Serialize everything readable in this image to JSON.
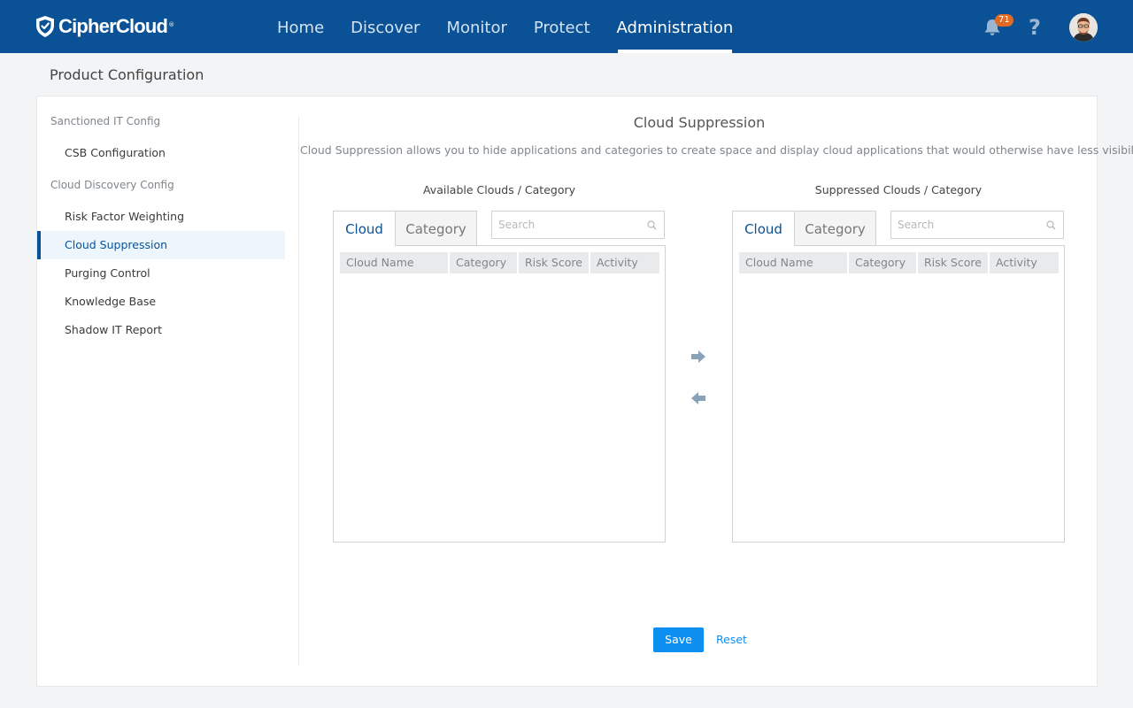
{
  "brand": {
    "name": "CipherCloud",
    "reg": "®"
  },
  "nav": {
    "items": [
      {
        "label": "Home"
      },
      {
        "label": "Discover"
      },
      {
        "label": "Monitor"
      },
      {
        "label": "Protect"
      },
      {
        "label": "Administration",
        "active": true
      }
    ]
  },
  "header_tools": {
    "notification_count": "71",
    "help_label": "?",
    "bell_icon": "bell-icon",
    "avatar_icon": "avatar"
  },
  "page": {
    "title": "Product Configuration"
  },
  "sidebar": {
    "groups": [
      {
        "heading": "Sanctioned IT Config",
        "items": [
          {
            "label": "CSB Configuration"
          }
        ]
      },
      {
        "heading": "Cloud Discovery Config",
        "items": [
          {
            "label": "Risk Factor Weighting"
          },
          {
            "label": "Cloud Suppression",
            "active": true
          },
          {
            "label": "Purging Control"
          },
          {
            "label": "Knowledge Base"
          },
          {
            "label": "Shadow IT Report"
          }
        ]
      }
    ]
  },
  "main": {
    "title": "Cloud Suppression",
    "description": "Cloud Suppression allows you to hide applications and categories to create space and display cloud applications that would otherwise have less visibility.",
    "available": {
      "label": "Available Clouds / Category",
      "tabs": [
        "Cloud",
        "Category"
      ],
      "search_placeholder": "Search",
      "columns": [
        "Cloud Name",
        "Category",
        "Risk Score",
        "Activity"
      ]
    },
    "suppressed": {
      "label": "Suppressed Clouds / Category",
      "tabs": [
        "Cloud",
        "Category"
      ],
      "search_placeholder": "Search",
      "columns": [
        "Cloud Name",
        "Category",
        "Risk Score",
        "Activity"
      ]
    },
    "actions": {
      "save": "Save",
      "reset": "Reset"
    }
  },
  "colors": {
    "header": "#0a5196",
    "accent": "#0d8ff2",
    "badge": "#e06a24"
  }
}
